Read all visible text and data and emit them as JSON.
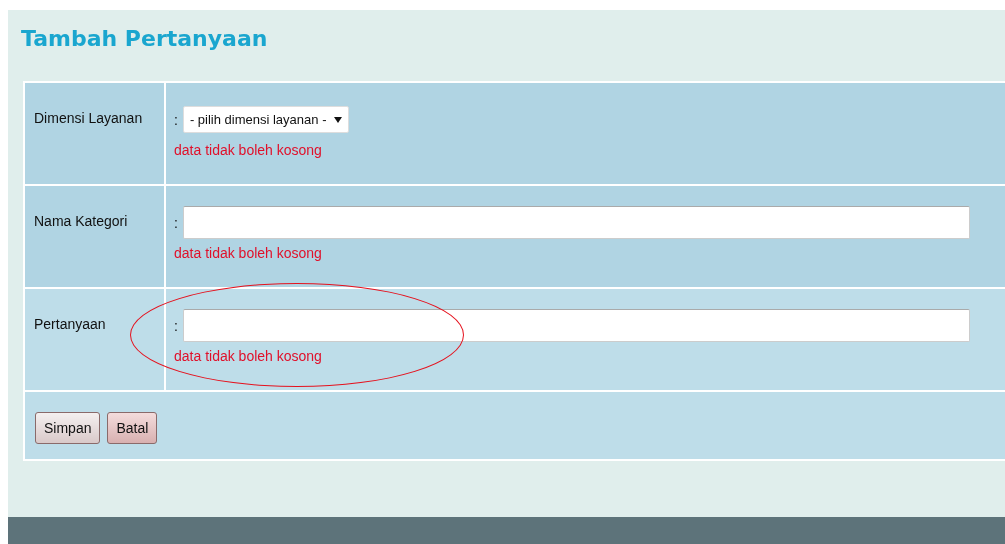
{
  "title": "Tambah Pertanyaan",
  "fields": [
    {
      "kind": "select",
      "label": "Dimensi Layanan",
      "separator": ":",
      "value": "- pilih dimensi layanan -",
      "error": "data tidak boleh kosong",
      "highlighted": false
    },
    {
      "kind": "text",
      "label": "Nama Kategori",
      "separator": ":",
      "error": "data tidak boleh kosong",
      "highlighted": false
    },
    {
      "kind": "text",
      "label": "Pertanyaan",
      "separator": ":",
      "error": "data tidak boleh kosong",
      "highlighted": true
    }
  ],
  "buttons": [
    "Simpan",
    "Batal"
  ]
}
